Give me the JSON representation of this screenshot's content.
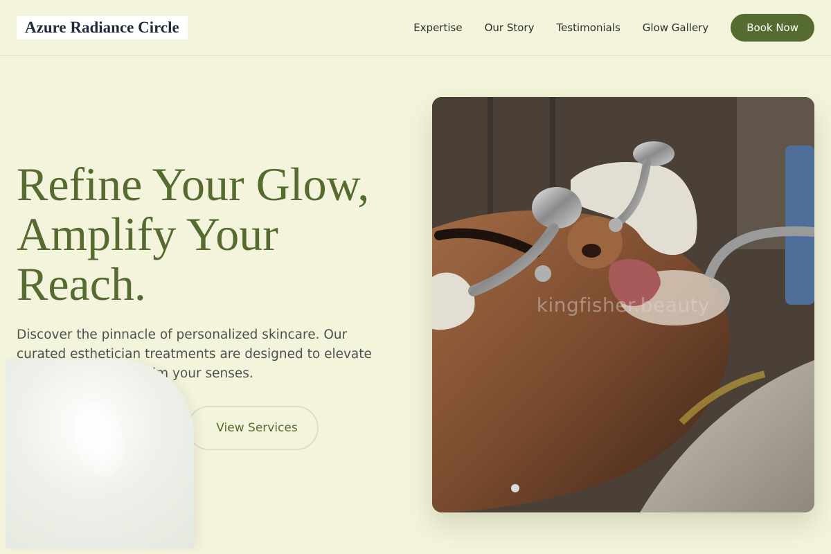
{
  "header": {
    "logo": "Azure Radiance Circle",
    "nav": [
      {
        "label": "Expertise"
      },
      {
        "label": "Our Story"
      },
      {
        "label": "Testimonials"
      },
      {
        "label": "Glow Gallery"
      }
    ],
    "cta": "Book Now"
  },
  "hero": {
    "headline_line1": "Refine Your Glow,",
    "headline_line2": "Amplify Your",
    "headline_line3": "Reach.",
    "subtext": "Discover the pinnacle of personalized skincare. Our curated esthetician treatments are designed to elevate your radiance and calm your senses.",
    "secondary_button": "View Services",
    "photo_watermark": "kingfisher.beauty"
  },
  "colors": {
    "background": "#f4f4dc",
    "accent": "#566b2f",
    "heading": "#566b2f"
  }
}
